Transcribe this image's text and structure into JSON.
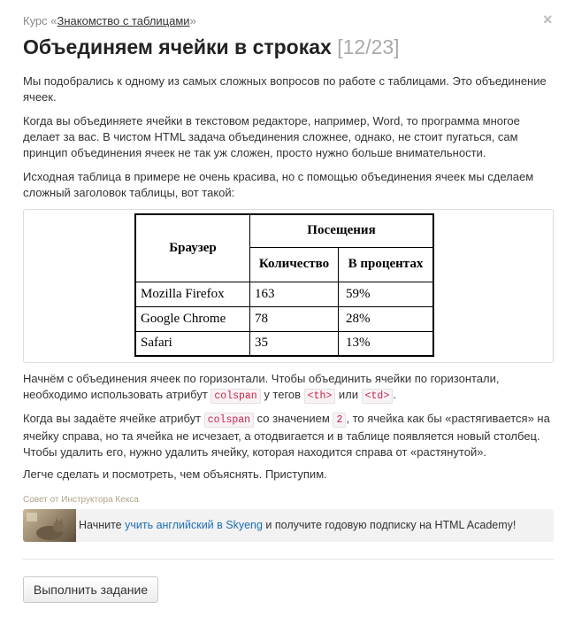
{
  "header": {
    "course_prefix": "Курс «",
    "course_link": "Знакомство с таблицами",
    "course_suffix": "»",
    "close_glyph": "×",
    "title": "Объединяем ячейки в строках",
    "counter": "[12/23]"
  },
  "paragraphs": {
    "p1": "Мы подобрались к одному из самых сложных вопросов по работе с таблицами. Это объединение ячеек.",
    "p2": "Когда вы объединяете ячейки в текстовом редакторе, например, Word, то программа многое делает за вас. В чистом HTML задача объединения сложнее, однако, не стоит пугаться, сам принцип объединения ячеек не так уж сложен, просто нужно больше внимательности.",
    "p3": "Исходная таблица в примере не очень красива, но с помощью объединения ячеек мы сделаем сложный заголовок таблицы, вот такой:",
    "p4": {
      "t1": "Начнём с объединения ячеек по горизонтали. Чтобы объединить ячейки по горизонтали, необходимо использовать атрибут ",
      "c1": "colspan",
      "t2": " у тегов ",
      "c2": "<th>",
      "t3": " или ",
      "c3": "<td>",
      "t4": "."
    },
    "p5": {
      "t1": "Когда вы задаёте ячейке атрибут ",
      "c1": "colspan",
      "t2": " со значением ",
      "c2": "2",
      "t3": ", то ячейка как бы «растягивается» на ячейку справа, но та ячейка не исчезает, а отодвигается и в таблице появляется новый столбец. Чтобы удалить его, нужно удалить ячейку, которая находится справа от «растянутой»."
    },
    "p6": "Легче сделать и посмотреть, чем объяснять. Приступим."
  },
  "demo_table": {
    "header_browser": "Браузер",
    "header_visits": "Посещения",
    "header_count": "Количество",
    "header_percent": "В процентах",
    "rows": [
      {
        "browser": "Mozilla Firefox",
        "count": "163",
        "percent": "59%"
      },
      {
        "browser": "Google Chrome",
        "count": "78",
        "percent": "28%"
      },
      {
        "browser": "Safari",
        "count": "35",
        "percent": "13%"
      }
    ]
  },
  "tip": {
    "title": "Совет от Инструктора Кекса",
    "text_before": "Начните ",
    "link": "учить английский в Skyeng",
    "text_after": " и получите годовую подписку на HTML Academy!"
  },
  "action": {
    "button_label": "Выполнить задание"
  }
}
